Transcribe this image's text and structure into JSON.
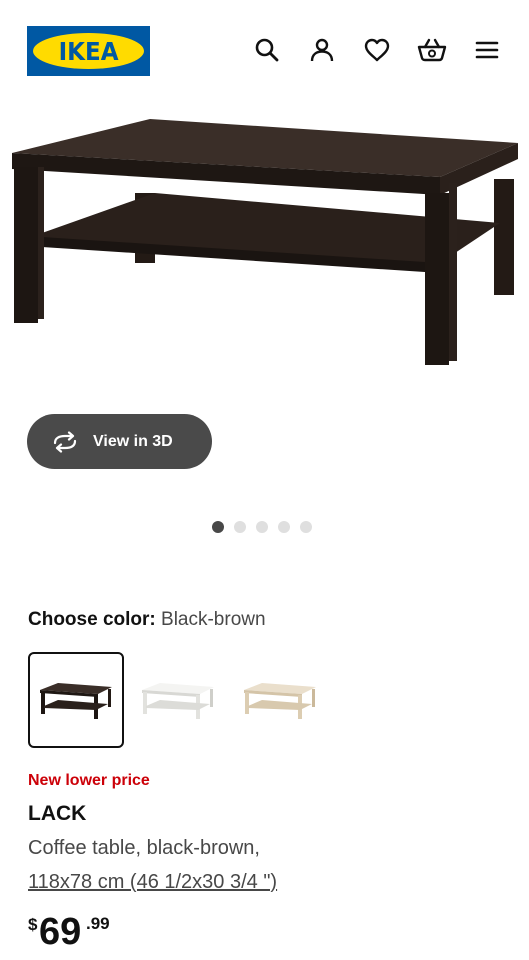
{
  "header": {
    "logo_text": "IKEA",
    "icons": [
      "search-icon",
      "account-icon",
      "heart-icon",
      "cart-icon",
      "menu-icon"
    ]
  },
  "gallery": {
    "view3d_label": "View in 3D",
    "dot_count": 5,
    "active_dot": 1
  },
  "color_choice": {
    "label": "Choose color:",
    "value": "Black-brown",
    "options": [
      "black-brown",
      "white",
      "white stained oak effect"
    ],
    "selected_index": 0
  },
  "product": {
    "badge": "New lower price",
    "name": "LACK",
    "description": "Coffee table, black-brown,",
    "dimensions": "118x78 cm (46 1/2x30 3/4 \")",
    "price_currency": "$",
    "price_integer": "69",
    "price_decimal": ".99"
  },
  "colors": {
    "ikea_blue": "#0058a3",
    "ikea_yellow": "#ffdb00",
    "badge_red": "#cc0008",
    "button_dark": "#4a4a4a"
  }
}
